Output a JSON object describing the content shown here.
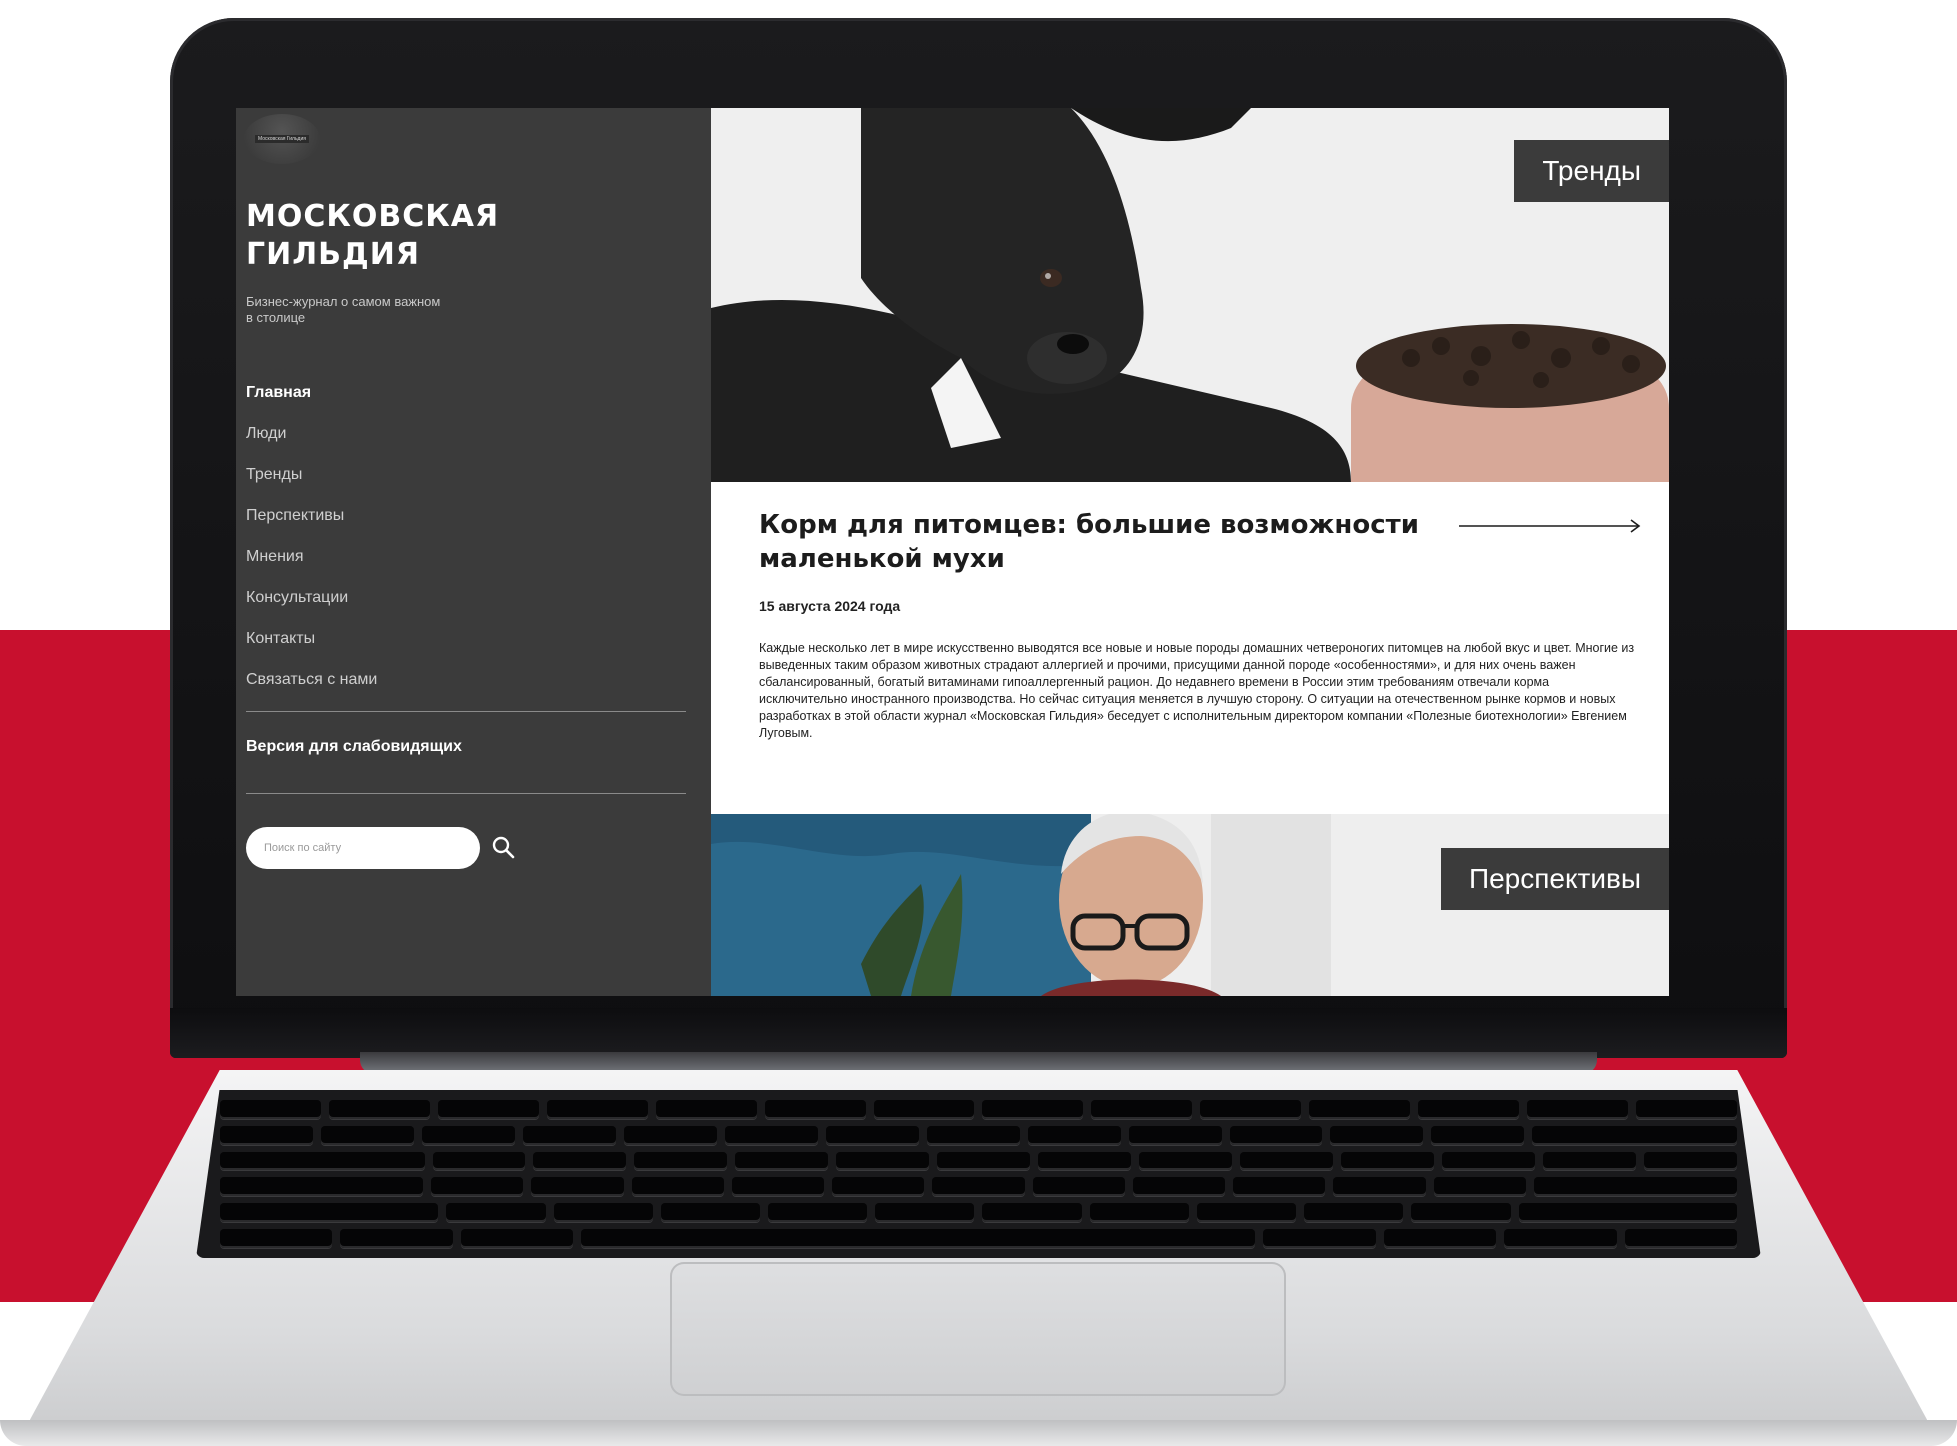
{
  "sidebar": {
    "logo_text": "Московская Гильдия",
    "brand_title": "МОСКОВСКАЯ ГИЛЬДИЯ",
    "tagline": "Бизнес-журнал о самом важном в столице",
    "nav": [
      {
        "label": "Главная",
        "active": true
      },
      {
        "label": "Люди"
      },
      {
        "label": "Тренды"
      },
      {
        "label": "Перспективы"
      },
      {
        "label": "Мнения"
      },
      {
        "label": "Консультации"
      },
      {
        "label": "Контакты"
      },
      {
        "label": "Связаться с нами"
      }
    ],
    "accessibility_label": "Версия для слабовидящих",
    "search": {
      "placeholder": "Поиск по сайту",
      "value": ""
    }
  },
  "content": {
    "tags": {
      "trends": "Тренды",
      "prospects": "Перспективы"
    },
    "article": {
      "title": "Корм для питомцев: большие возможности маленькой мухи",
      "date": "15 августа 2024 года",
      "body": "Каждые несколько лет в мире искусственно выводятся все новые и новые породы домашних четвероногих питомцев на любой вкус и цвет. Многие из выведенных таким образом животных страдают аллергией и прочими, присущими данной породе «особенностями», и для них очень важен сбалансированный, богатый витаминами гипоаллергенный рацион. До недавнего времени в России этим требованиям отвечали корма исключительно иностранного производства. Но сейчас ситуация меняется в лучшую сторону. О ситуации на отечественном рынке кормов и новых разработках в этой области журнал «Московская Гильдия» беседует с исполнительным директором компании «Полезные биотехнологии» Евгением Луговым."
    }
  },
  "colors": {
    "backdrop_red": "#c8102e",
    "sidebar_bg": "#3b3b3b",
    "tag_bg": "#3b3b3b",
    "text_dark": "#1c1c1c"
  }
}
